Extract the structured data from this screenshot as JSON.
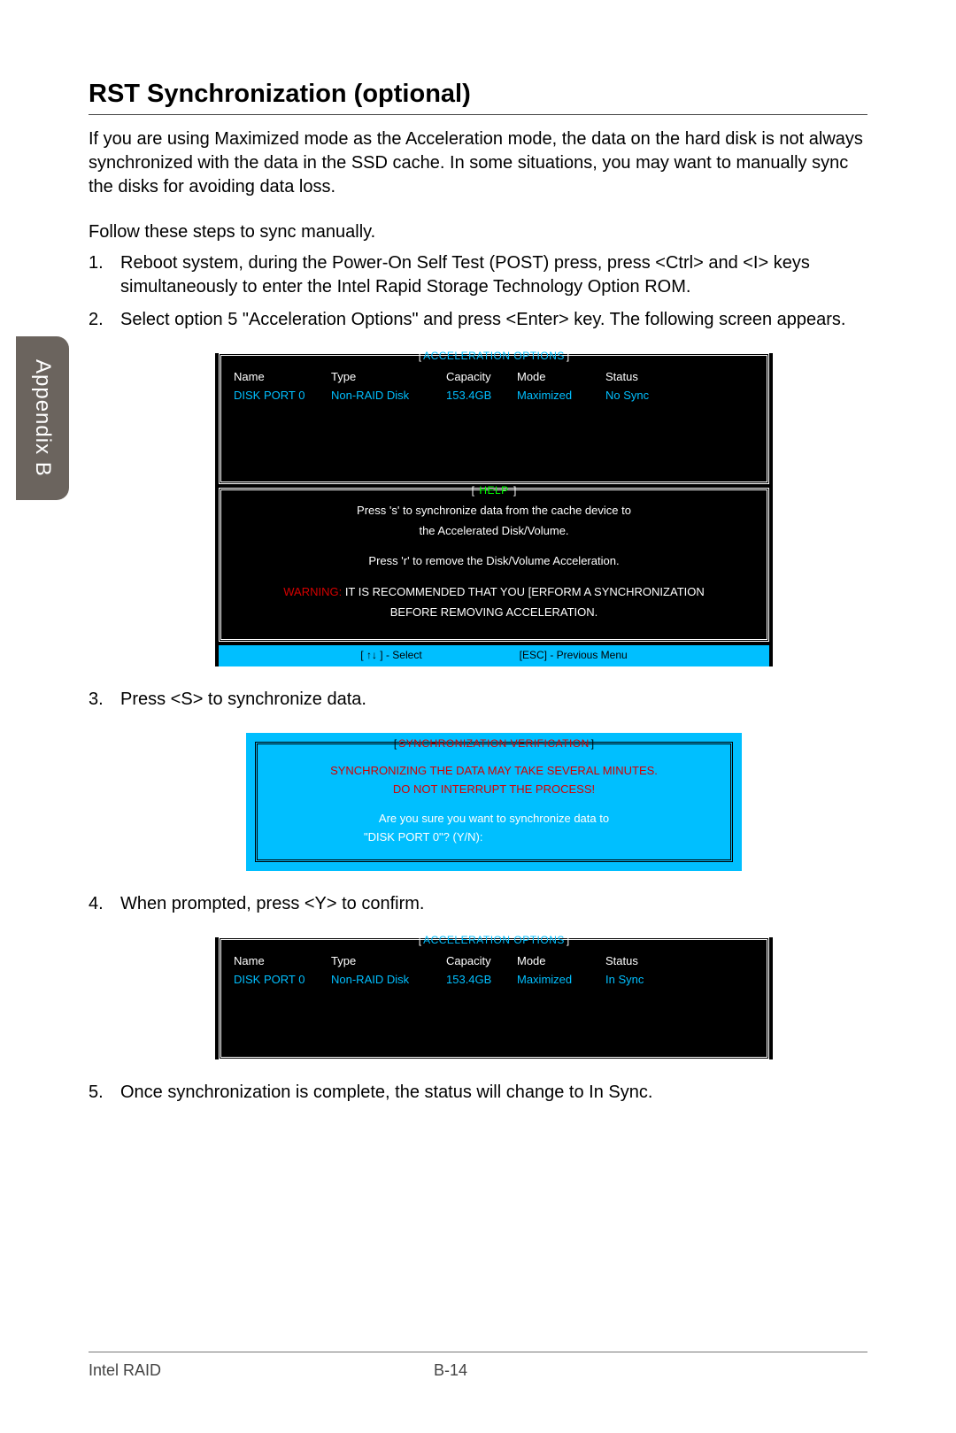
{
  "side_tab": "Appendix B",
  "title": "RST Synchronization (optional)",
  "intro": "If you are using Maximized mode as the Acceleration mode, the data on the hard disk is not always synchronized with the data in the SSD cache. In some situations, you may want to manually sync the disks for avoiding data loss.",
  "follow": "Follow these steps to sync manually.",
  "steps": {
    "s1": "Reboot system, during the Power-On Self Test (POST) press, press <Ctrl> and <I> keys simultaneously to enter the Intel Rapid Storage Technology Option ROM.",
    "s2": "Select option 5 \"Acceleration Options\" and press <Enter> key. The following screen appears.",
    "s3": "Press <S> to synchronize data.",
    "s4": "When prompted, press <Y> to confirm.",
    "s5": "Once synchronization is complete, the status will change to In Sync."
  },
  "bios1": {
    "title": "ACCELERATION OPTIONS",
    "headers": {
      "name": "Name",
      "type": "Type",
      "capacity": "Capacity",
      "mode": "Mode",
      "status": "Status"
    },
    "row": {
      "name": "DISK PORT 0",
      "type": "Non-RAID Disk",
      "capacity": "153.4GB",
      "mode": "Maximized",
      "status": "No Sync"
    },
    "help_title": "HELP",
    "help": {
      "l1": "Press 's' to synchronize data from the cache device to",
      "l2": "the Accelerated Disk/Volume.",
      "l3": "Press 'r' to remove the Disk/Volume Acceleration.",
      "warn_label": "WARNING:",
      "warn1": " IT IS RECOMMENDED THAT YOU [ERFORM A SYNCHRONIZATION",
      "warn2": "BEFORE REMOVING ACCELERATION."
    },
    "footer_left": "[ ↑↓ ] - Select",
    "footer_right": "[ESC] - Previous Menu"
  },
  "sync": {
    "title": "SYNCHRONIZATION VERIFICATION",
    "l1": "SYNCHRONIZING THE DATA MAY TAKE SEVERAL MINUTES.",
    "l2": "DO NOT INTERRUPT THE PROCESS!",
    "l3": "Are you sure you want to synchronize data to",
    "l4": "\"DISK PORT 0\"? (Y/N):"
  },
  "bios2": {
    "title": "ACCELERATION OPTIONS",
    "headers": {
      "name": "Name",
      "type": "Type",
      "capacity": "Capacity",
      "mode": "Mode",
      "status": "Status"
    },
    "row": {
      "name": "DISK PORT 0",
      "type": "Non-RAID Disk",
      "capacity": "153.4GB",
      "mode": "Maximized",
      "status": "In Sync"
    }
  },
  "footer": {
    "left": "Intel RAID",
    "page": "B-14"
  }
}
